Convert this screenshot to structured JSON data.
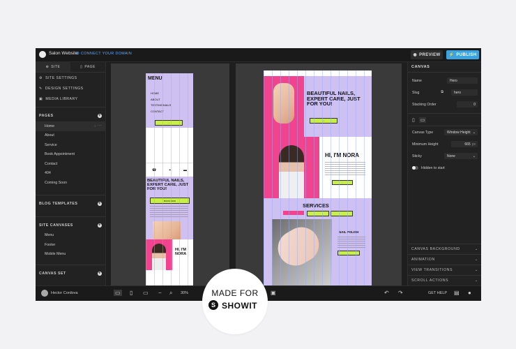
{
  "topbar": {
    "site_name": "Salon Website",
    "connect": "CONNECT YOUR DOMAIN",
    "preview": "PREVIEW",
    "publish": "PUBLISH"
  },
  "sidebar": {
    "tab_site": "SITE",
    "tab_page": "PAGE",
    "site_settings": "SITE SETTINGS",
    "design_settings": "DESIGN SETTINGS",
    "media_library": "MEDIA LIBRARY",
    "pages_label": "PAGES",
    "pages": [
      "Home",
      "About",
      "Service",
      "Book Appointment",
      "Contact",
      "404",
      "Coming Soon"
    ],
    "blog_templates": "BLOG TEMPLATES",
    "site_canvases": "SITE CANVASES",
    "canvases": [
      "Menu",
      "Footer",
      "Mobile Menu"
    ],
    "canvas_set": "CANVAS SET"
  },
  "mobile": {
    "menu_title": "MENU",
    "menu_items": [
      "HOME",
      "ABOUT",
      "TESTIMONIALS",
      "CONTACT"
    ],
    "hero": "BEAUTIFUL NAILS, EXPERT CARE, JUST FOR YOU!",
    "book": "BOOK NOW",
    "hi": "HI, I'M NORA"
  },
  "desktop": {
    "hero": "BEAUTIFUL NAILS, EXPERT CARE, JUST FOR YOU!",
    "hi": "HI, I'M NORA",
    "services": "SERVICES",
    "nail_polish": "NAIL POLISH"
  },
  "panel": {
    "title": "CANVAS",
    "name_label": "Name",
    "name_val": "Hero",
    "slug_label": "Slug",
    "slug_val": "hero",
    "stack_label": "Stacking Order",
    "stack_val": "0",
    "ctype_label": "Canvas Type",
    "ctype_val": "Window Height",
    "minh_label": "Minimum Height",
    "minh_val": "665",
    "minh_unit": "px",
    "sticky_label": "Sticky",
    "sticky_val": "None",
    "hidden": "Hidden to start",
    "accordions": [
      "CANVAS BACKGROUND",
      "ANIMATION",
      "VIEW TRANSITIONS",
      "SCROLL ACTIONS"
    ]
  },
  "bottombar": {
    "user": "Hector Cordova",
    "zoom": "30%",
    "help": "GET HELP"
  },
  "badge": {
    "line1": "MADE FOR",
    "line2": "SHOWIT"
  },
  "colors": {
    "accent": "#3aa3e0",
    "lavender": "#cfc0f2",
    "pink": "#f2438f",
    "lime": "#c7ef45"
  }
}
